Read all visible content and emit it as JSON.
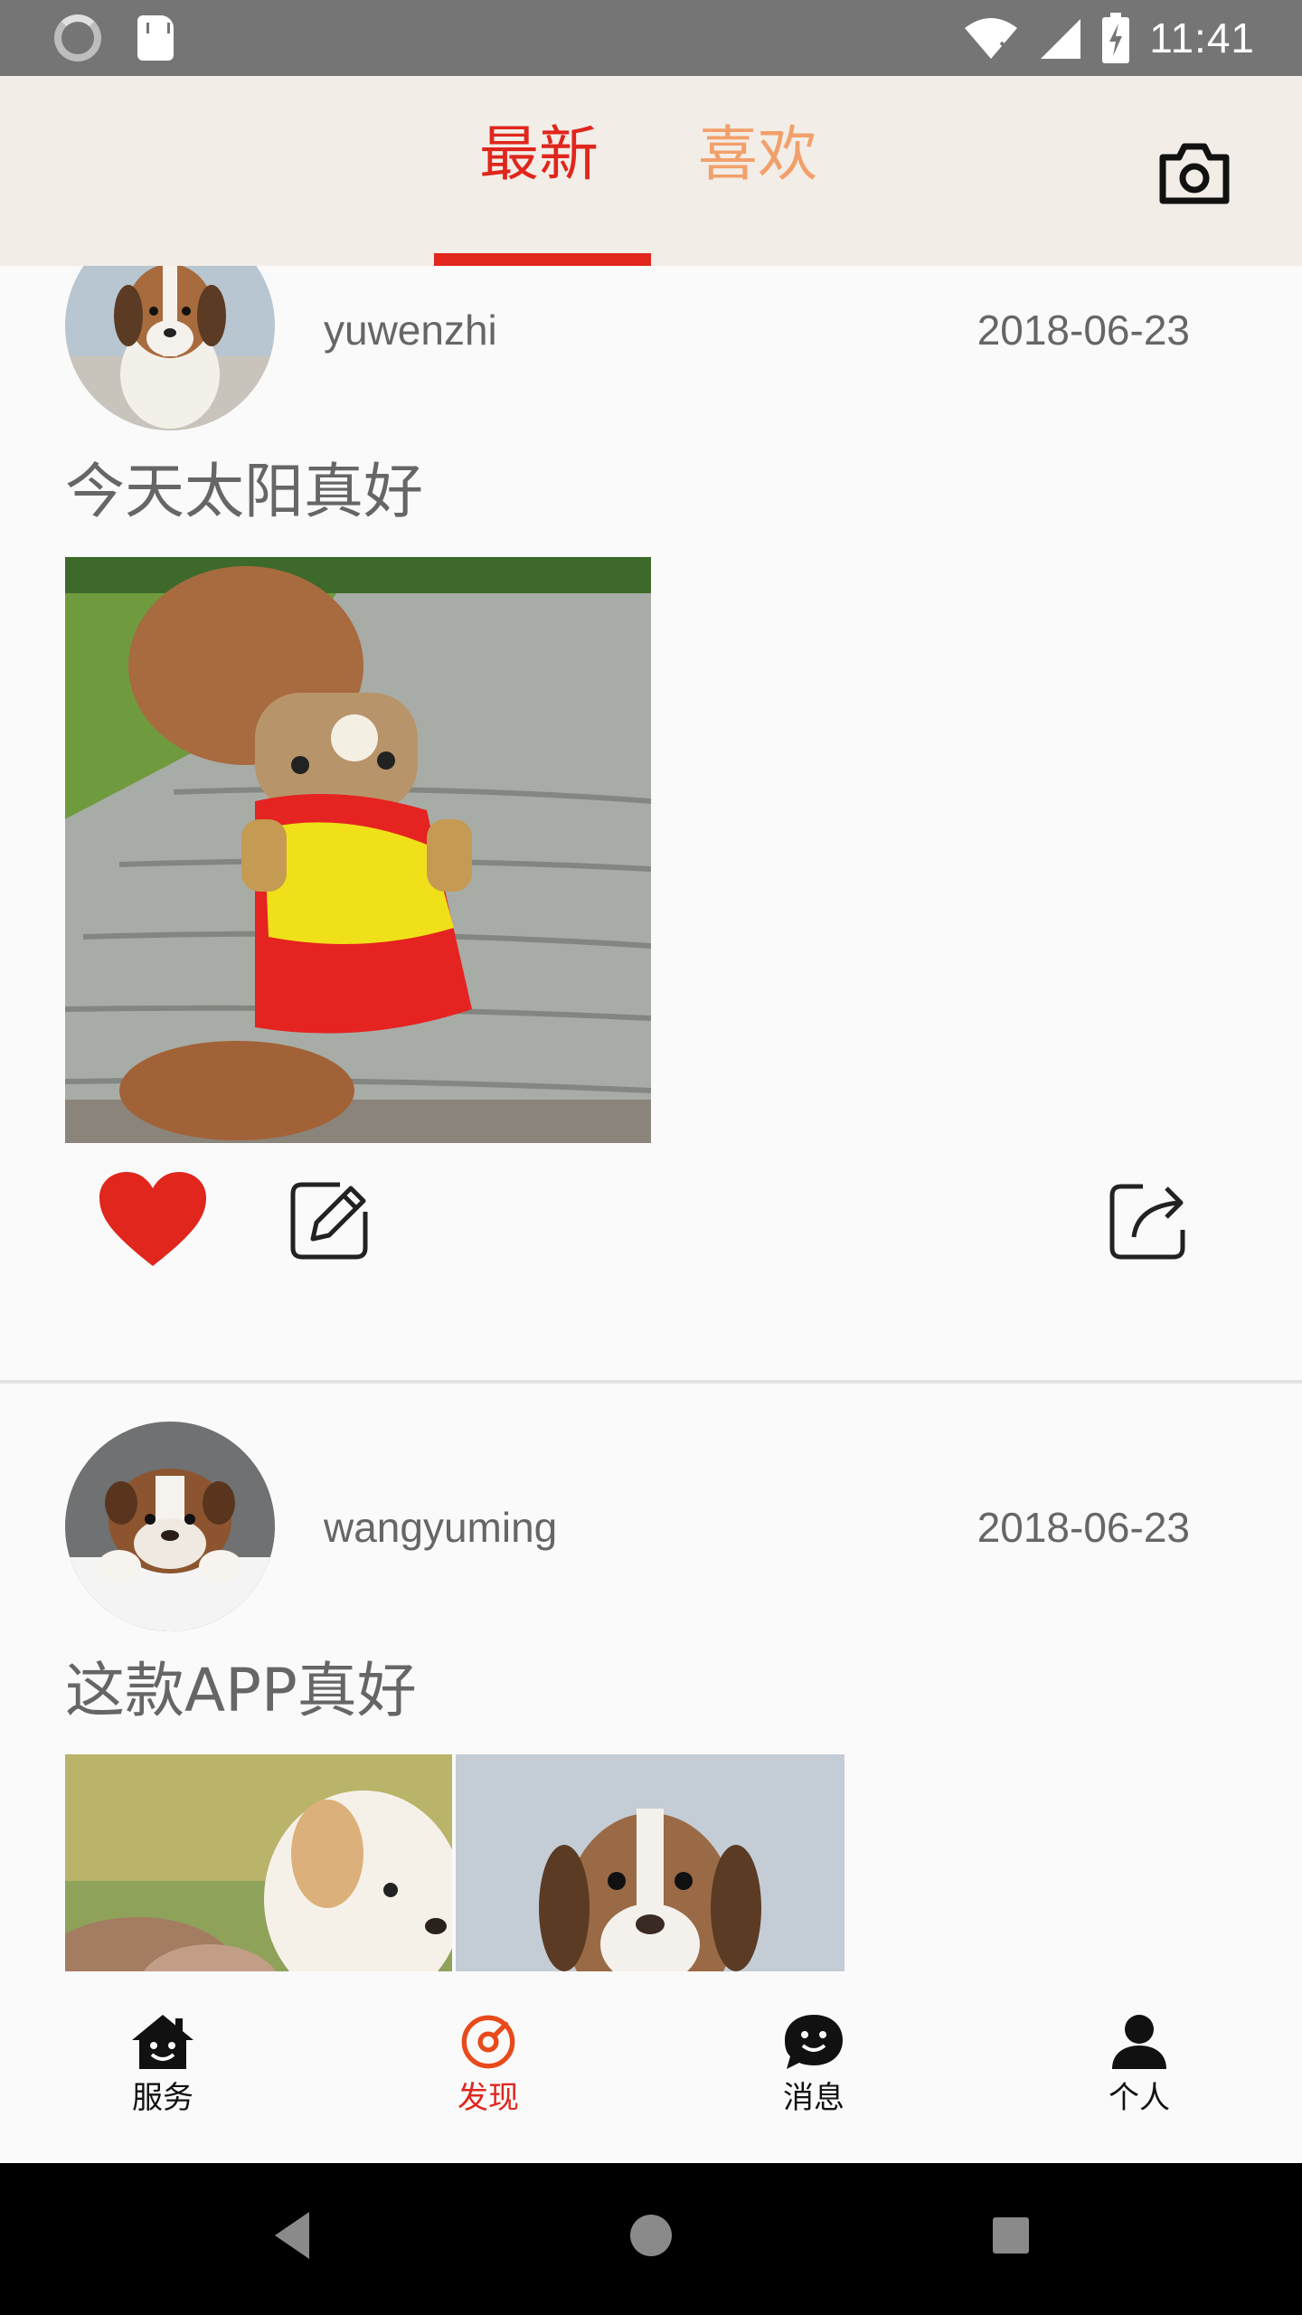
{
  "status_bar": {
    "time": "11:41",
    "icons": [
      "sync-spinner-icon",
      "sd-card-icon",
      "wifi-icon",
      "signal-icon",
      "battery-charging-icon"
    ]
  },
  "header": {
    "tabs": [
      {
        "label": "最新",
        "active": true
      },
      {
        "label": "喜欢",
        "active": false
      }
    ],
    "camera_icon": "camera-icon",
    "accent_color": "#e0261d",
    "inactive_tab_color": "#f2a06b",
    "background": "#f2ede7"
  },
  "posts": [
    {
      "username": "yuwenzhi",
      "date": "2018-06-23",
      "text": "今天太阳真好",
      "avatar": "beagle puppy avatar",
      "images": [
        "poodle in teddy bear jacket on stone path"
      ],
      "liked": true,
      "actions": [
        "heart-icon",
        "edit-icon",
        "share-icon"
      ]
    },
    {
      "username": "wangyuming",
      "date": "2018-06-23",
      "text": "这款APP真好",
      "avatar": "bulldog puppy avatar",
      "images": [
        "fluffy white puppy on grass",
        "beagle puppy portrait"
      ]
    }
  ],
  "bottom_nav": {
    "items": [
      {
        "label": "服务",
        "icon": "home-face-icon",
        "active": false
      },
      {
        "label": "发现",
        "icon": "discover-icon",
        "active": true
      },
      {
        "label": "消息",
        "icon": "message-icon",
        "active": false
      },
      {
        "label": "个人",
        "icon": "person-icon",
        "active": false
      }
    ]
  },
  "system_nav": [
    "back-icon",
    "home-icon",
    "recents-icon"
  ]
}
